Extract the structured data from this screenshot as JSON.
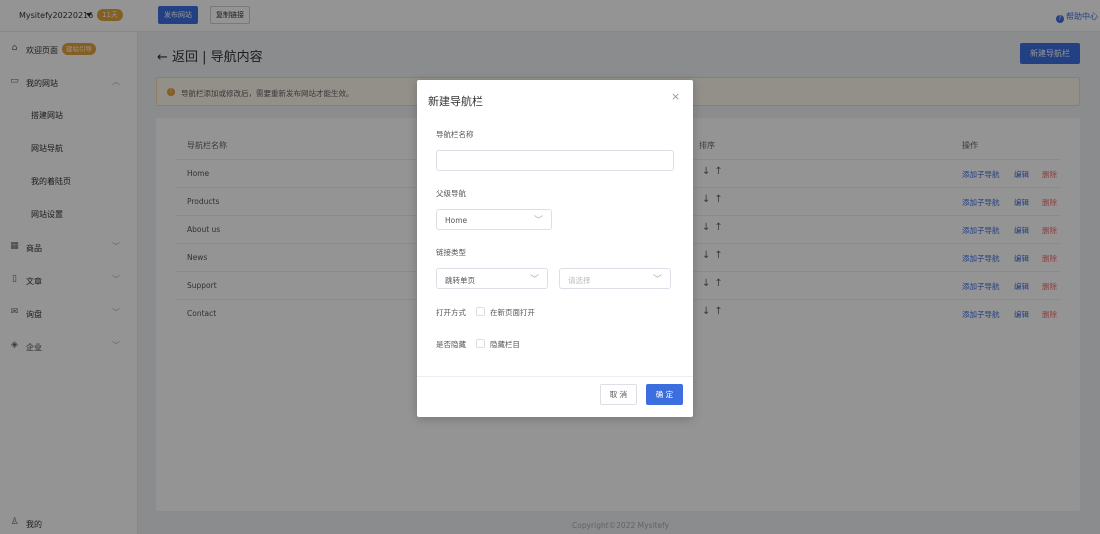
{
  "topbar": {
    "site_name": "Mysitefy20220216",
    "days_badge": "11天",
    "publish_label": "发布网站",
    "copy_link_label": "复制链接",
    "help_label": "帮助中心"
  },
  "sidebar": {
    "welcome": {
      "label": "欢迎页面",
      "badge": "建站引导",
      "icon": "home-icon"
    },
    "my_site": {
      "label": "我的网站",
      "icon": "monitor-icon"
    },
    "my_site_children": [
      "搭建网站",
      "网站导航",
      "我的着陆页",
      "网站设置"
    ],
    "groups": [
      {
        "label": "商品",
        "icon": "grid-icon"
      },
      {
        "label": "文章",
        "icon": "document-icon"
      },
      {
        "label": "询盘",
        "icon": "mail-icon"
      },
      {
        "label": "企业",
        "icon": "shield-icon"
      }
    ],
    "me_label": "我的"
  },
  "main": {
    "back_title": "← 返回 | 导航内容",
    "new_nav_button": "新建导航栏",
    "alert_text": "导航栏添加或修改后，需要重新发布网站才能生效。",
    "table": {
      "col_name": "导航栏名称",
      "col_sort": "排序",
      "col_ops": "操作",
      "rows": [
        "Home",
        "Products",
        "About us",
        "News",
        "Support",
        "Contact"
      ],
      "sort_arrows": "↓↑",
      "op_add": "添加子导航",
      "op_edit": "编辑",
      "op_delete": "删除"
    }
  },
  "footer": "Copyright©2022  Mysitefy",
  "modal": {
    "title": "新建导航栏",
    "close_glyph": "×",
    "name_label": "导航栏名称",
    "name_value": "",
    "parent_label": "父级导航",
    "parent_value": "Home",
    "link_type_label": "链接类型",
    "link_type_value": "跳转单页",
    "link_target_placeholder": "请选择",
    "open_mode_label": "打开方式",
    "open_new_label": "在新页面打开",
    "hide_label": "是否隐藏",
    "hide_check_label": "隐藏栏目",
    "cancel_label": "取 消",
    "ok_label": "确 定"
  },
  "colors": {
    "primary": "#3d6ee0",
    "warning": "#e6a23c",
    "danger": "#f56c6c",
    "overlay": "rgba(0,0,0,0.42)"
  }
}
